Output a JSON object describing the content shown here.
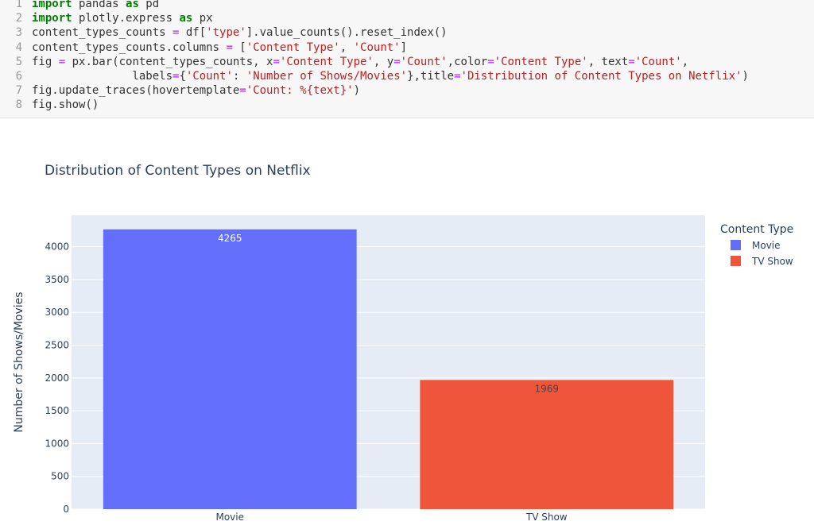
{
  "code": {
    "lines": [
      {
        "n": "1",
        "tokens": [
          {
            "t": "import",
            "c": "kw"
          },
          {
            "t": " pandas "
          },
          {
            "t": "as",
            "c": "kw"
          },
          {
            "t": " pd"
          }
        ]
      },
      {
        "n": "2",
        "tokens": [
          {
            "t": "import",
            "c": "kw"
          },
          {
            "t": " plotly.express "
          },
          {
            "t": "as",
            "c": "kw"
          },
          {
            "t": " px"
          }
        ]
      },
      {
        "n": "3",
        "tokens": [
          {
            "t": "content_types_counts "
          },
          {
            "t": "=",
            "c": "op"
          },
          {
            "t": " df["
          },
          {
            "t": "'type'",
            "c": "str"
          },
          {
            "t": "].value_counts().reset_index()"
          }
        ]
      },
      {
        "n": "4",
        "tokens": [
          {
            "t": "content_types_counts.columns "
          },
          {
            "t": "=",
            "c": "op"
          },
          {
            "t": " ["
          },
          {
            "t": "'Content Type'",
            "c": "str"
          },
          {
            "t": ", "
          },
          {
            "t": "'Count'",
            "c": "str"
          },
          {
            "t": "]"
          }
        ]
      },
      {
        "n": "5",
        "tokens": [
          {
            "t": "fig "
          },
          {
            "t": "=",
            "c": "op"
          },
          {
            "t": " px.bar(content_types_counts, x"
          },
          {
            "t": "=",
            "c": "op"
          },
          {
            "t": "'Content Type'",
            "c": "str"
          },
          {
            "t": ", y"
          },
          {
            "t": "=",
            "c": "op"
          },
          {
            "t": "'Count'",
            "c": "str"
          },
          {
            "t": ",color"
          },
          {
            "t": "=",
            "c": "op"
          },
          {
            "t": "'Content Type'",
            "c": "str"
          },
          {
            "t": ", text"
          },
          {
            "t": "=",
            "c": "op"
          },
          {
            "t": "'Count'",
            "c": "str"
          },
          {
            "t": ","
          }
        ]
      },
      {
        "n": "6",
        "tokens": [
          {
            "t": "               labels"
          },
          {
            "t": "=",
            "c": "op"
          },
          {
            "t": "{"
          },
          {
            "t": "'Count'",
            "c": "str"
          },
          {
            "t": ": "
          },
          {
            "t": "'Number of Shows/Movies'",
            "c": "str"
          },
          {
            "t": "},title"
          },
          {
            "t": "=",
            "c": "op"
          },
          {
            "t": "'Distribution of Content Types on Netflix'",
            "c": "str"
          },
          {
            "t": ")"
          }
        ]
      },
      {
        "n": "7",
        "tokens": [
          {
            "t": "fig.update_traces(hovertemplate"
          },
          {
            "t": "=",
            "c": "op"
          },
          {
            "t": "'Count: %{text}'",
            "c": "str"
          },
          {
            "t": ")"
          }
        ]
      },
      {
        "n": "8",
        "tokens": [
          {
            "t": "fig.show()"
          }
        ]
      }
    ]
  },
  "chart_data": {
    "type": "bar",
    "title": "Distribution of Content Types on Netflix",
    "xlabel": "",
    "ylabel": "Number of Shows/Movies",
    "categories": [
      "Movie",
      "TV Show"
    ],
    "values": [
      4265,
      1969
    ],
    "bar_labels": [
      "4265",
      "1969"
    ],
    "colors": [
      "#636efa",
      "#ef553b"
    ],
    "label_colors": [
      "#ffffff",
      "#444444"
    ],
    "ylim": [
      0,
      4480
    ],
    "yticks": [
      0,
      500,
      1000,
      1500,
      2000,
      2500,
      3000,
      3500,
      4000
    ],
    "ytick_labels": [
      "0",
      "500",
      "1000",
      "1500",
      "2000",
      "2500",
      "3000",
      "3500",
      "4000"
    ],
    "grid": true,
    "plot_bg": "#e5ecf6",
    "legend": {
      "title": "Content Type",
      "placement": "right",
      "entries": [
        "Movie",
        "TV Show"
      ]
    }
  }
}
